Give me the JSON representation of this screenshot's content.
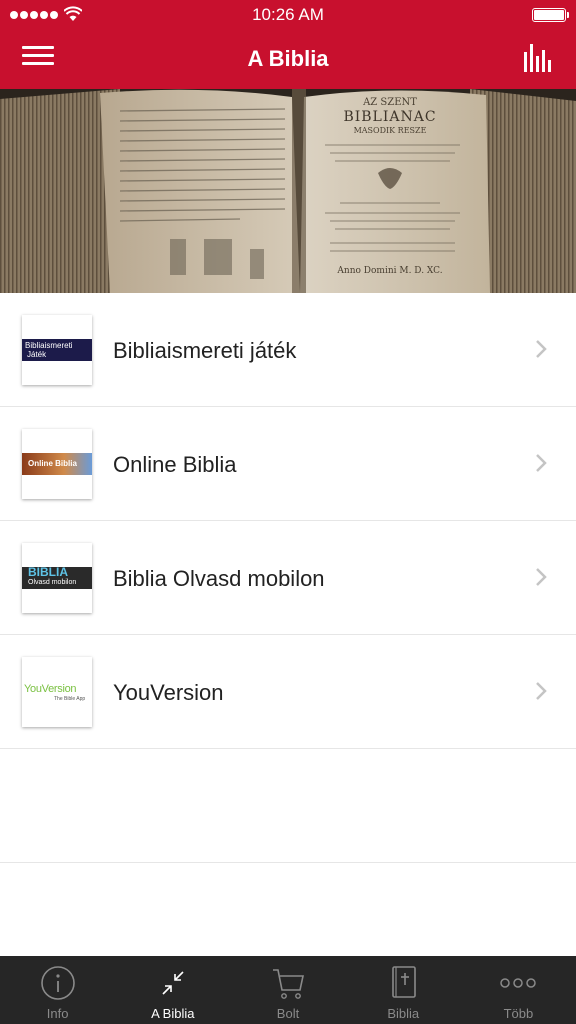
{
  "status_bar": {
    "time": "10:26 AM"
  },
  "nav": {
    "title": "A Biblia"
  },
  "colors": {
    "brand": "#c8102e",
    "tabbar": "#262626",
    "tab_inactive": "#8a8a8a",
    "tab_active": "#ffffff"
  },
  "banner": {
    "title_line1": "AZ SZENT",
    "title_line2": "BIBLIANAC",
    "subtitle": "MASODIK RESZE",
    "footer": "Anno Domini M. D. XC."
  },
  "list": {
    "items": [
      {
        "label": "Bibliaismereti játék",
        "thumb_text": "Bibliaismereti",
        "thumb_text2": "Játék"
      },
      {
        "label": "Online Biblia",
        "thumb_text": "Online Biblia"
      },
      {
        "label": "Biblia Olvasd mobilon",
        "thumb_text": "BIBLIA",
        "thumb_text2": "Olvasd mobilon"
      },
      {
        "label": "YouVersion",
        "thumb_text": "YouVersion",
        "thumb_text2": "The Bible App"
      }
    ]
  },
  "tabs": [
    {
      "label": "Info",
      "icon": "info-icon",
      "active": false
    },
    {
      "label": "A Biblia",
      "icon": "collapse-arrows-icon",
      "active": true
    },
    {
      "label": "Bolt",
      "icon": "cart-icon",
      "active": false
    },
    {
      "label": "Biblia",
      "icon": "bible-book-icon",
      "active": false
    },
    {
      "label": "Több",
      "icon": "more-dots-icon",
      "active": false
    }
  ]
}
